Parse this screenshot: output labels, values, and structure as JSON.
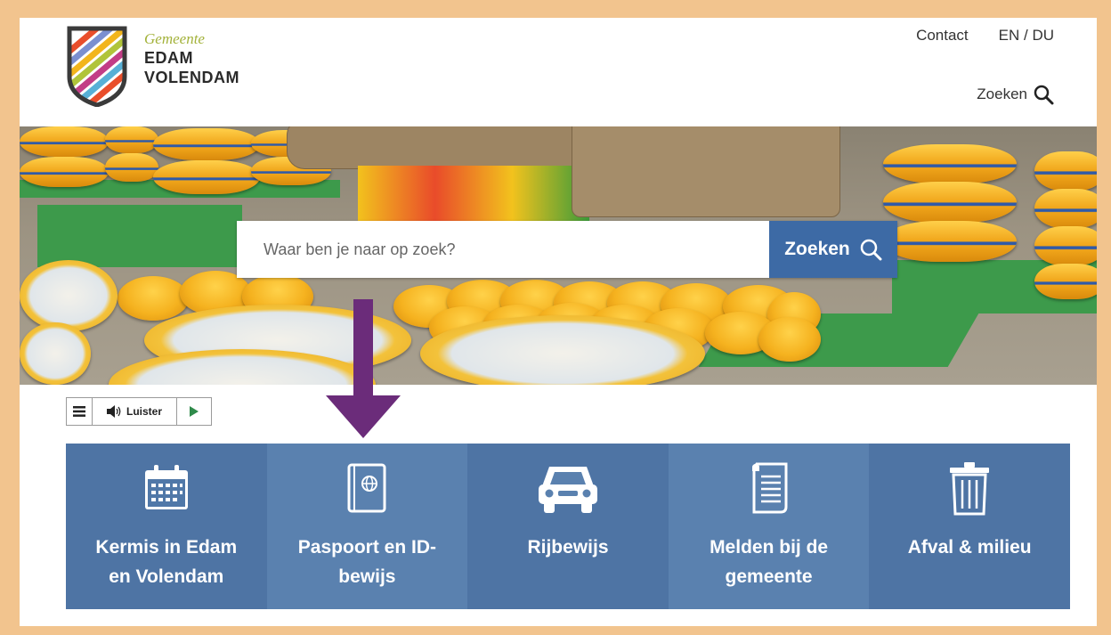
{
  "header": {
    "brand_top": "Gemeente",
    "brand_line1": "EDAM",
    "brand_line2": "VOLENDAM",
    "nav": {
      "contact": "Contact",
      "lang": "EN / DU"
    },
    "search_label": "Zoeken"
  },
  "hero": {
    "search_placeholder": "Waar ben je naar op zoek?",
    "search_button": "Zoeken"
  },
  "readspeaker": {
    "listen_label": "Luister"
  },
  "tiles": [
    {
      "label": "Kermis in Edam en Volendam",
      "icon": "calendar-icon"
    },
    {
      "label": "Paspoort en ID-bewijs",
      "icon": "passport-icon"
    },
    {
      "label": "Rijbewijs",
      "icon": "car-icon"
    },
    {
      "label": "Melden bij de gemeente",
      "icon": "scroll-icon"
    },
    {
      "label": "Afval & milieu",
      "icon": "trash-icon"
    }
  ],
  "colors": {
    "border": "#f2c48e",
    "tile_blue": "#4f75a6",
    "search_button": "#3d6aa5",
    "arrow": "#6b2c7a",
    "brand_green": "#a3b23a"
  }
}
